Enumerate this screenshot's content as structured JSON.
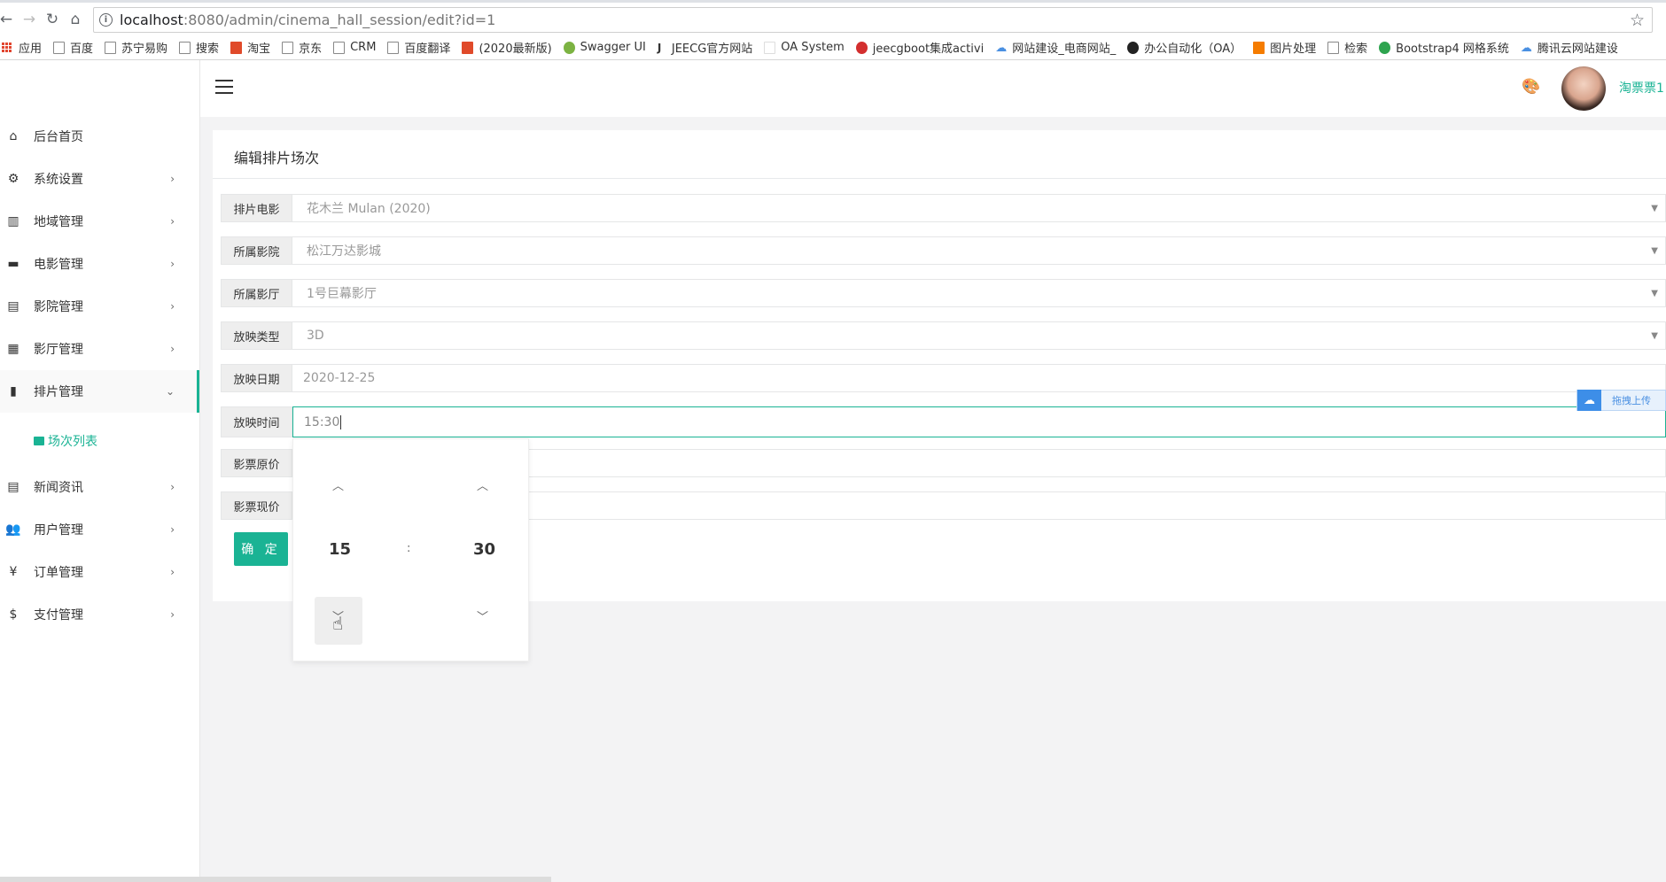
{
  "browser": {
    "url_host": "localhost",
    "url_path": ":8080/admin/cinema_hall_session/edit?id=1",
    "bookmarks": [
      "应用",
      "百度",
      "苏宁易购",
      "搜索",
      "淘宝",
      "京东",
      "CRM",
      "百度翻译",
      "(2020最新版)",
      "Swagger UI",
      "JEECG官方网站",
      "OA System",
      "jeecgboot集成activi",
      "网站建设_电商网站_",
      "办公自动化（OA）",
      "图片处理",
      "检索",
      "Bootstrap4 网格系统",
      "腾讯云网站建设"
    ]
  },
  "sidebar": {
    "items": [
      {
        "label": "后台首页",
        "icon": "home-icon"
      },
      {
        "label": "系统设置",
        "icon": "gear-icon"
      },
      {
        "label": "地域管理",
        "icon": "map-icon"
      },
      {
        "label": "电影管理",
        "icon": "film-icon"
      },
      {
        "label": "影院管理",
        "icon": "store-icon"
      },
      {
        "label": "影厅管理",
        "icon": "building-icon"
      },
      {
        "label": "排片管理",
        "icon": "book-icon"
      },
      {
        "label": "新闻资讯",
        "icon": "news-icon"
      },
      {
        "label": "用户管理",
        "icon": "users-icon"
      },
      {
        "label": "订单管理",
        "icon": "yen-icon"
      },
      {
        "label": "支付管理",
        "icon": "dollar-icon"
      }
    ],
    "sub_item": "场次列表"
  },
  "header": {
    "username": "淘票票1"
  },
  "form": {
    "title": "编辑排片场次",
    "fields": [
      {
        "label": "排片电影",
        "value": "花木兰 Mulan (2020)"
      },
      {
        "label": "所属影院",
        "value": "松江万达影城"
      },
      {
        "label": "所属影厅",
        "value": "1号巨幕影厅"
      },
      {
        "label": "放映类型",
        "value": "3D"
      },
      {
        "label": "放映日期",
        "value": "2020-12-25"
      },
      {
        "label": "放映时间",
        "value": "15:30"
      },
      {
        "label": "影票原价",
        "value": ""
      },
      {
        "label": "影票现价",
        "value": ""
      }
    ],
    "submit": "确 定"
  },
  "time_picker": {
    "hour": "15",
    "separator": ":",
    "minute": "30"
  },
  "upload_widget": {
    "label": "拖拽上传"
  },
  "colors": {
    "accent": "#1ab394"
  }
}
